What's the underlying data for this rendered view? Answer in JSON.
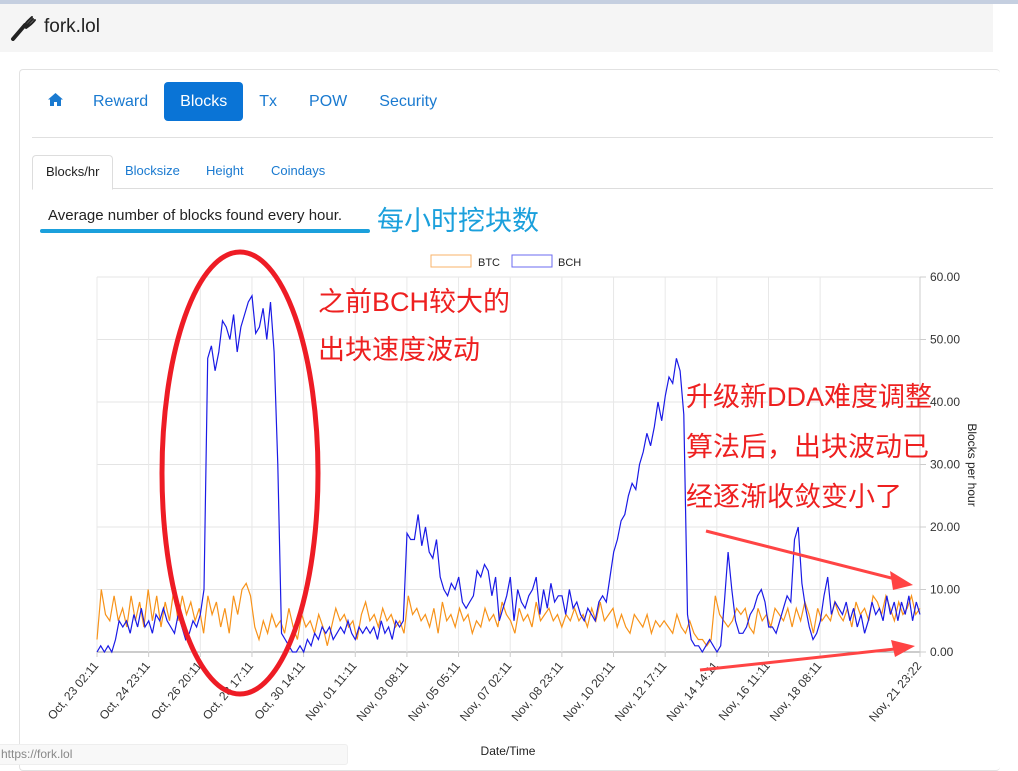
{
  "browser": {
    "status_url": "https://fork.lol"
  },
  "navbar": {
    "brand": "fork.lol",
    "brand_icon": "fork-icon"
  },
  "nav_pills": [
    {
      "label": "",
      "icon": "home-icon",
      "active": false
    },
    {
      "label": "Reward",
      "active": false
    },
    {
      "label": "Blocks",
      "active": true
    },
    {
      "label": "Tx",
      "active": false
    },
    {
      "label": "POW",
      "active": false
    },
    {
      "label": "Security",
      "active": false
    }
  ],
  "sub_tabs": [
    {
      "label": "Blocks/hr",
      "active": true
    },
    {
      "label": "Blocksize",
      "active": false
    },
    {
      "label": "Height",
      "active": false
    },
    {
      "label": "Coindays",
      "active": false
    }
  ],
  "description": "Average number of blocks found every hour.",
  "annotations": {
    "description_cn": "每小时挖块数",
    "left_note": [
      "之前BCH较大的",
      "出块速度波动"
    ],
    "right_note": [
      "升级新DDA难度调整",
      "算法后，出块波动已",
      "经逐渐收敛变小了"
    ],
    "colors": {
      "highlight": "#1ba0dc",
      "note": "#ee2020"
    }
  },
  "chart_data": {
    "type": "line",
    "title": "",
    "xlabel": "Date/Time",
    "ylabel": "Blocks per hour",
    "ylim": [
      0,
      60
    ],
    "y_ticks": [
      "0.00",
      "10.00",
      "20.00",
      "30.00",
      "40.00",
      "50.00",
      "60.00"
    ],
    "y_axis_side": "right",
    "grid": true,
    "legend": {
      "placement": "top-center",
      "entries": [
        "BTC",
        "BCH"
      ]
    },
    "x_ticks": [
      "Oct, 23 02:11",
      "Oct, 24 23:11",
      "Oct, 26 20:11",
      "Oct, 28 17:11",
      "Oct, 30 14:11",
      "Nov, 01 11:11",
      "Nov, 03 08:11",
      "Nov, 05 05:11",
      "Nov, 07 02:11",
      "Nov, 08 23:11",
      "Nov, 10 20:11",
      "Nov, 12 17:11",
      "Nov, 14 14:11",
      "Nov, 16 11:11",
      "Nov, 18 08:11",
      "Nov, 21 23:22"
    ],
    "x_tick_hours": [
      0,
      45,
      90,
      135,
      180,
      225,
      270,
      315,
      360,
      405,
      450,
      495,
      540,
      585,
      630,
      717
    ],
    "x_range_hours": [
      0,
      717
    ],
    "series": [
      {
        "name": "BTC",
        "color": "#f7931a",
        "values": [
          2,
          10,
          6,
          5,
          9,
          5,
          7,
          4,
          9,
          5,
          8,
          4,
          10,
          5,
          9,
          4,
          8,
          5,
          10,
          5,
          9,
          6,
          8,
          5,
          7,
          3,
          9,
          6,
          8,
          4,
          7,
          3,
          9,
          6,
          10,
          11,
          9,
          4,
          2,
          5,
          3,
          6,
          4,
          5,
          3,
          7,
          4,
          2,
          6,
          4,
          5,
          3,
          6,
          4,
          1,
          4,
          7,
          5,
          6,
          4,
          5,
          2,
          6,
          8,
          5,
          6,
          4,
          7,
          5,
          6,
          4,
          5,
          3,
          9,
          6,
          7,
          5,
          6,
          4,
          7,
          3,
          8,
          5,
          6,
          4,
          7,
          5,
          6,
          3,
          5,
          4,
          7,
          5,
          6,
          4,
          8,
          6,
          5,
          3,
          7,
          5,
          6,
          4,
          8,
          5,
          6,
          7,
          5,
          6,
          4,
          6,
          5,
          7,
          5,
          6,
          4,
          7,
          5,
          8,
          5,
          6,
          7,
          4,
          6,
          4,
          3,
          6,
          5,
          4,
          6,
          3,
          5,
          4,
          5,
          4,
          3,
          6,
          4,
          3,
          5,
          3,
          2,
          2,
          1,
          2,
          9,
          6,
          5,
          4,
          5,
          7,
          6,
          7,
          4,
          3,
          7,
          5,
          6,
          4,
          7,
          6,
          5,
          7,
          4,
          7,
          5,
          8,
          6,
          3,
          7,
          5,
          6,
          5,
          8,
          6,
          5,
          7,
          4,
          8,
          6,
          7,
          5,
          9,
          8,
          6,
          9,
          7,
          5,
          8,
          6,
          7,
          9,
          6,
          7
        ]
      },
      {
        "name": "BCH",
        "color": "#1a1ae6",
        "values": [
          0,
          1,
          0,
          1,
          0,
          2,
          5,
          4,
          5,
          3,
          6,
          4,
          7,
          4,
          5,
          3,
          6,
          5,
          7,
          5,
          4,
          3,
          6,
          4,
          2,
          3,
          5,
          4,
          6,
          10,
          47,
          49,
          45,
          48,
          53,
          52,
          50,
          54,
          48,
          52,
          54,
          56,
          57,
          51,
          52,
          55,
          50,
          56,
          48,
          30,
          3,
          2,
          1,
          0,
          0,
          1,
          0,
          2,
          1,
          3,
          2,
          4,
          3,
          4,
          2,
          3,
          4,
          3,
          5,
          3,
          2,
          4,
          3,
          4,
          3,
          4,
          2,
          5,
          3,
          4,
          2,
          5,
          4,
          5,
          19,
          18,
          18,
          22,
          17,
          20,
          16,
          15,
          18,
          12,
          10,
          9,
          11,
          10,
          12,
          8,
          7,
          8,
          9,
          13,
          12,
          14,
          13,
          9,
          12,
          5,
          7,
          9,
          12,
          5,
          10,
          8,
          7,
          9,
          10,
          12,
          6,
          10,
          7,
          11,
          8,
          9,
          9,
          6,
          10,
          7,
          8,
          6,
          5,
          7,
          6,
          5,
          8,
          9,
          8,
          12,
          16,
          18,
          21,
          22,
          25,
          27,
          26,
          30,
          32,
          35,
          33,
          36,
          40,
          37,
          41,
          44,
          43,
          47,
          45,
          38,
          6,
          2,
          1,
          1,
          0,
          1,
          2,
          1,
          0,
          1,
          8,
          16,
          10,
          5,
          3,
          3,
          4,
          6,
          7,
          9,
          10,
          8,
          4,
          4,
          3,
          5,
          7,
          9,
          8,
          18,
          20,
          11,
          7,
          4,
          2,
          3,
          5,
          9,
          12,
          6,
          8,
          7,
          6,
          8,
          5,
          7,
          4,
          6,
          3,
          5,
          8,
          6,
          7,
          5,
          9,
          6,
          8,
          5,
          8,
          6,
          9,
          5,
          8,
          6
        ]
      }
    ]
  }
}
